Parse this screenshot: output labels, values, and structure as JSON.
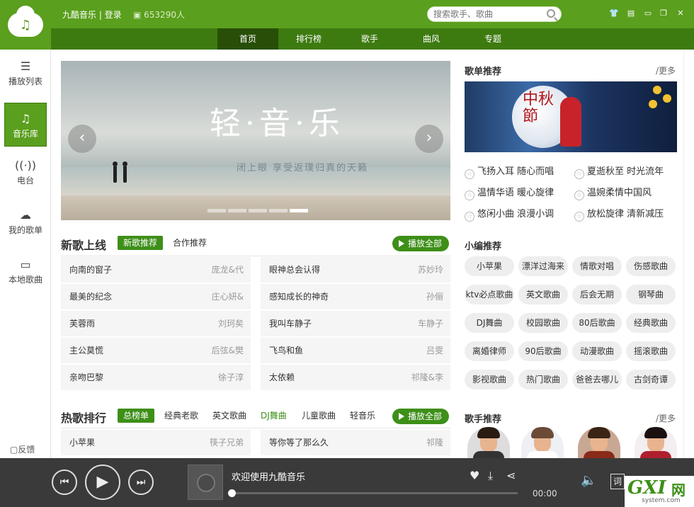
{
  "app": {
    "brand": "九酷音乐 | 登录",
    "users_count": "653290人",
    "colors": {
      "primary": "#5a9f1d",
      "nav": "#3d7a10",
      "accent": "#3d8f18"
    }
  },
  "search": {
    "placeholder": "搜索歌手、歌曲",
    "icon": "search-icon"
  },
  "window_controls": [
    "skin-icon",
    "mini-icon",
    "minimize-icon",
    "maximize-icon",
    "close-icon"
  ],
  "nav": {
    "tabs": [
      "首页",
      "排行榜",
      "歌手",
      "曲风",
      "专题"
    ],
    "active": 0
  },
  "sidebar": {
    "items": [
      {
        "label": "播放列表",
        "icon": "playlist-icon"
      },
      {
        "label": "音乐库",
        "icon": "music-note-icon",
        "active": true
      },
      {
        "label": "电台",
        "icon": "wifi-icon"
      },
      {
        "label": "我的歌单",
        "icon": "cloud-icon"
      },
      {
        "label": "本地歌曲",
        "icon": "monitor-icon"
      }
    ],
    "feedback": "反馈"
  },
  "banner": {
    "title": "轻·音·乐",
    "subtitle": "闭上眼 享受返璞归真的天籁",
    "slides": 5,
    "active_slide": 4
  },
  "new_songs": {
    "title": "新歌上线",
    "tabs": [
      "新歌推荐",
      "合作推荐"
    ],
    "play_all": "播放全部",
    "rows": [
      [
        {
          "t": "向南的窗子",
          "a": "庞龙&代"
        },
        {
          "t": "眼神总会认得",
          "a": "苏妙玲"
        }
      ],
      [
        {
          "t": "最美的纪念",
          "a": "庄心妍&"
        },
        {
          "t": "感知成长的神奇",
          "a": "孙俪"
        }
      ],
      [
        {
          "t": "芙蓉雨",
          "a": "刘珂矣"
        },
        {
          "t": "我叫车静子",
          "a": "车静子"
        }
      ],
      [
        {
          "t": "主公莫慌",
          "a": "后弦&樊"
        },
        {
          "t": "飞鸟和鱼",
          "a": "吕雯"
        }
      ],
      [
        {
          "t": "亲吻巴黎",
          "a": "徐子淳"
        },
        {
          "t": "太依赖",
          "a": "祁隆&李"
        }
      ]
    ]
  },
  "hot_songs": {
    "title": "热歌排行",
    "tabs": [
      "总榜单",
      "经典老歌",
      "英文歌曲",
      "DJ舞曲",
      "儿童歌曲",
      "轻音乐"
    ],
    "play_all": "播放全部",
    "rows": [
      [
        {
          "t": "小苹果",
          "a": "筷子兄弟"
        },
        {
          "t": "等你等了那么久",
          "a": "祁隆"
        }
      ]
    ]
  },
  "playlists": {
    "title": "歌单推荐",
    "more": "/更多",
    "poster_text": "中秋節",
    "items": [
      "飞扬入耳 随心而唱",
      "夏逝秋至 时光流年",
      "温情华语 暖心旋律",
      "温婉柔情中国风",
      "悠闲小曲 浪漫小调",
      "放松旋律 清新减压"
    ]
  },
  "editor_picks": {
    "title": "小编推荐",
    "tags": [
      "小苹果",
      "漂洋过海来",
      "情歌对唱",
      "伤感歌曲",
      "ktv必点歌曲",
      "英文歌曲",
      "后会无期",
      "钢琴曲",
      "DJ舞曲",
      "校园歌曲",
      "80后歌曲",
      "经典歌曲",
      "离婚律师",
      "90后歌曲",
      "动漫歌曲",
      "摇滚歌曲",
      "影视歌曲",
      "热门歌曲",
      "爸爸去哪儿",
      "古剑奇谭"
    ]
  },
  "artists": {
    "title": "歌手推荐",
    "more": "/更多",
    "count": 4
  },
  "player": {
    "now_playing": "欢迎使用九酷音乐",
    "time": "00:00",
    "progress": 0,
    "lyric_label": "词"
  },
  "watermark": {
    "big": "GXI",
    "cn": "网",
    "site": "system.com"
  }
}
